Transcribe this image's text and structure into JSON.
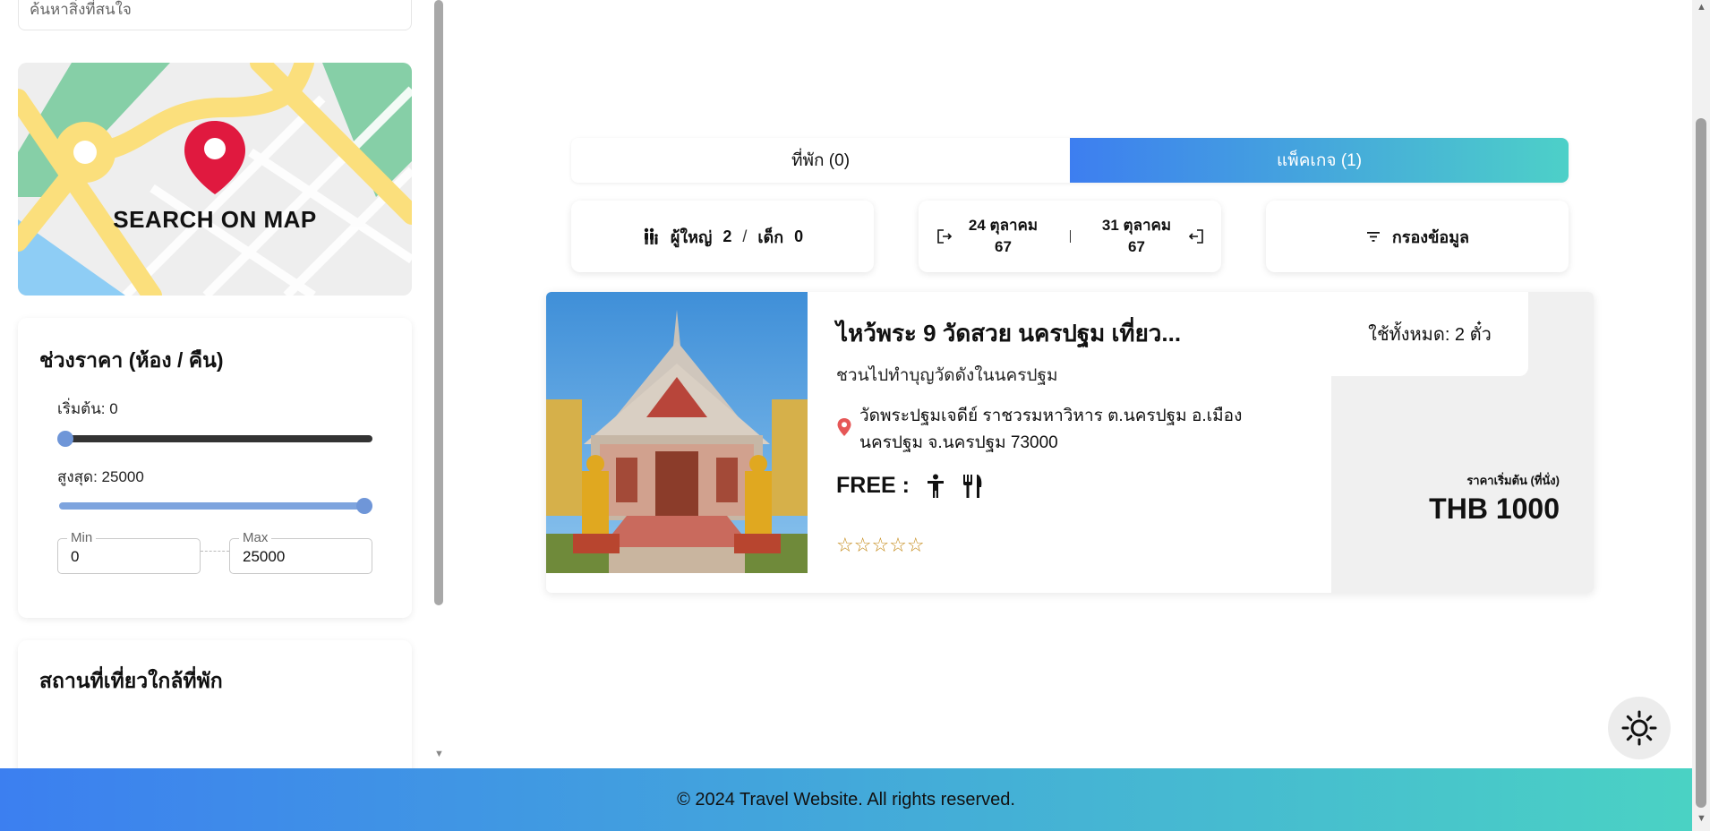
{
  "sidebar": {
    "search_placeholder": "ค้นหาสิ่งที่สนใจ",
    "map_label": "SEARCH ON MAP",
    "price": {
      "title": "ช่วงราคา (ห้อง / คืน)",
      "min_label": "เริ่มต้น: 0",
      "max_label": "สูงสุด: 25000",
      "min_legend": "Min",
      "max_legend": "Max",
      "min_value": "0",
      "max_value": "25000",
      "min_level": 0,
      "max_level": 1
    },
    "nearby_title": "สถานที่เที่ยวใกล้ที่พัก"
  },
  "tabs": {
    "accommodation": "ที่พัก (0)",
    "package": "แพ็คเกจ (1)"
  },
  "guests": {
    "adult_label": "ผู้ใหญ่",
    "adult_count": "2",
    "separator": "/",
    "child_label": "เด็ก",
    "child_count": "0"
  },
  "dates": {
    "checkin_line1": "24 ตุลาคม",
    "checkin_line2": "67",
    "checkout_line1": "31 ตุลาคม",
    "checkout_line2": "67"
  },
  "filter_label": "กรองข้อมูล",
  "result": {
    "title": "ไหว้พระ 9 วัดสวย นครปฐม เที่ยว...",
    "subtitle": "ชวนไปทำบุญวัดดังในนครปฐม",
    "address": "วัดพระปฐมเจดีย์ ราชวรมหาวิหาร ต.นครปฐม อ.เมือง นครปฐม จ.นครปฐม 73000",
    "free_label": "FREE :",
    "stars": "☆☆☆☆☆",
    "usage": "ใช้ทั้งหมด: 2 ตั๋ว",
    "price_caption": "ราคาเริ่มต้น (ที่นั่ง)",
    "price_value": "THB 1000"
  },
  "footer": "© 2024 Travel Website. All rights reserved.",
  "colors": {
    "accent_start": "#3d7ef0",
    "accent_end": "#4dd0c8",
    "pin": "#e0193f",
    "star": "#c58b1a"
  },
  "icons": [
    "map-pin-icon",
    "people-icon",
    "checkin-icon",
    "checkout-icon",
    "filter-icon",
    "location-icon",
    "accessible-icon",
    "restaurant-icon",
    "sun-icon"
  ]
}
